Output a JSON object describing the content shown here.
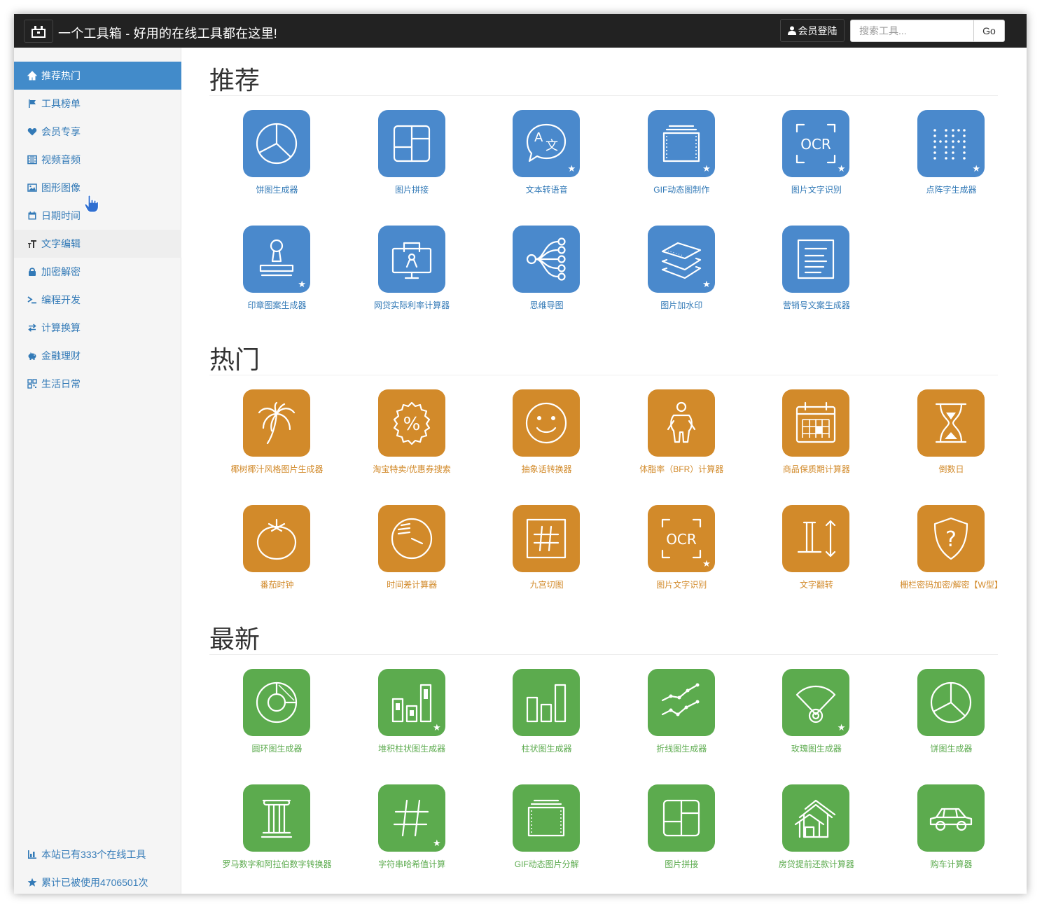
{
  "header": {
    "title": "一个工具箱 - 好用的在线工具都在这里!",
    "login_label": "会员登陆",
    "search_placeholder": "搜索工具...",
    "go_label": "Go"
  },
  "sidebar": {
    "items": [
      {
        "label": "推荐热门",
        "icon": "home-icon"
      },
      {
        "label": "工具榜单",
        "icon": "flag-icon"
      },
      {
        "label": "会员专享",
        "icon": "heart-icon"
      },
      {
        "label": "视频音频",
        "icon": "film-icon"
      },
      {
        "label": "图形图像",
        "icon": "picture-icon"
      },
      {
        "label": "日期时间",
        "icon": "calendar-icon"
      },
      {
        "label": "文字编辑",
        "icon": "text-size-icon"
      },
      {
        "label": "加密解密",
        "icon": "lock-icon"
      },
      {
        "label": "编程开发",
        "icon": "terminal-icon"
      },
      {
        "label": "计算换算",
        "icon": "transfer-icon"
      },
      {
        "label": "金融理财",
        "icon": "piggy-bank-icon"
      },
      {
        "label": "生活日常",
        "icon": "qrcode-icon"
      }
    ],
    "stats": [
      {
        "label": "本站已有333个在线工具",
        "icon": "stats-icon"
      },
      {
        "label": "累计已被使用4706501次",
        "icon": "star-icon"
      }
    ]
  },
  "sections": [
    {
      "title": "推荐",
      "color": "#4a89cc",
      "tools": [
        {
          "label": "饼图生成器",
          "icon": "pie-chart-icon",
          "star": false
        },
        {
          "label": "图片拼接",
          "icon": "layout-icon",
          "star": false
        },
        {
          "label": "文本转语音",
          "icon": "translate-bubble-icon",
          "star": true
        },
        {
          "label": "GIF动态图制作",
          "icon": "frames-icon",
          "star": true
        },
        {
          "label": "图片文字识别",
          "icon": "ocr-icon",
          "star": true
        },
        {
          "label": "点阵字生成器",
          "icon": "dot-matrix-icon",
          "star": true
        },
        {
          "label": "印章图案生成器",
          "icon": "stamp-icon",
          "star": true
        },
        {
          "label": "网贷实际利率计算器",
          "icon": "computer-icon",
          "star": false
        },
        {
          "label": "思维导图",
          "icon": "mind-map-icon",
          "star": false
        },
        {
          "label": "图片加水印",
          "icon": "layers-icon",
          "star": true
        },
        {
          "label": "营销号文案生成器",
          "icon": "document-icon",
          "star": false
        }
      ]
    },
    {
      "title": "热门",
      "color": "#d28a2a",
      "tools": [
        {
          "label": "椰树椰汁风格图片生成器",
          "icon": "palm-tree-icon",
          "star": false
        },
        {
          "label": "淘宝特卖/优惠券搜索",
          "icon": "discount-badge-icon",
          "star": false
        },
        {
          "label": "抽象话转换器",
          "icon": "smiley-icon",
          "star": false
        },
        {
          "label": "体脂率（BFR）计算器",
          "icon": "body-icon",
          "star": false
        },
        {
          "label": "商品保质期计算器",
          "icon": "calendar-grid-icon",
          "star": false
        },
        {
          "label": "倒数日",
          "icon": "hourglass-icon",
          "star": false
        },
        {
          "label": "番茄时钟",
          "icon": "tomato-icon",
          "star": false
        },
        {
          "label": "时间差计算器",
          "icon": "clock-icon",
          "star": false
        },
        {
          "label": "九宫切图",
          "icon": "grid-icon",
          "star": false
        },
        {
          "label": "图片文字识别",
          "icon": "ocr-icon",
          "star": true
        },
        {
          "label": "文字翻转",
          "icon": "flip-text-icon",
          "star": false
        },
        {
          "label": "栅栏密码加密/解密【W型】",
          "icon": "shield-question-icon",
          "star": false
        }
      ]
    },
    {
      "title": "最新",
      "color": "#5cab4e",
      "tools": [
        {
          "label": "圆环图生成器",
          "icon": "donut-chart-icon",
          "star": false
        },
        {
          "label": "堆积柱状图生成器",
          "icon": "stacked-bar-icon",
          "star": true
        },
        {
          "label": "柱状图生成器",
          "icon": "bar-chart-icon",
          "star": false
        },
        {
          "label": "折线图生成器",
          "icon": "line-chart-icon",
          "star": false
        },
        {
          "label": "玫瑰图生成器",
          "icon": "rose-chart-icon",
          "star": true
        },
        {
          "label": "饼图生成器",
          "icon": "pie-chart-icon",
          "star": false
        },
        {
          "label": "罗马数字和阿拉伯数字转换器",
          "icon": "column-icon",
          "star": false
        },
        {
          "label": "字符串哈希值计算",
          "icon": "hash-icon",
          "star": true
        },
        {
          "label": "GIF动态图片分解",
          "icon": "frames-icon",
          "star": false
        },
        {
          "label": "图片拼接",
          "icon": "layout-icon",
          "star": false
        },
        {
          "label": "房贷提前还款计算器",
          "icon": "house-icon",
          "star": false
        },
        {
          "label": "购车计算器",
          "icon": "car-icon",
          "star": false
        }
      ]
    }
  ]
}
